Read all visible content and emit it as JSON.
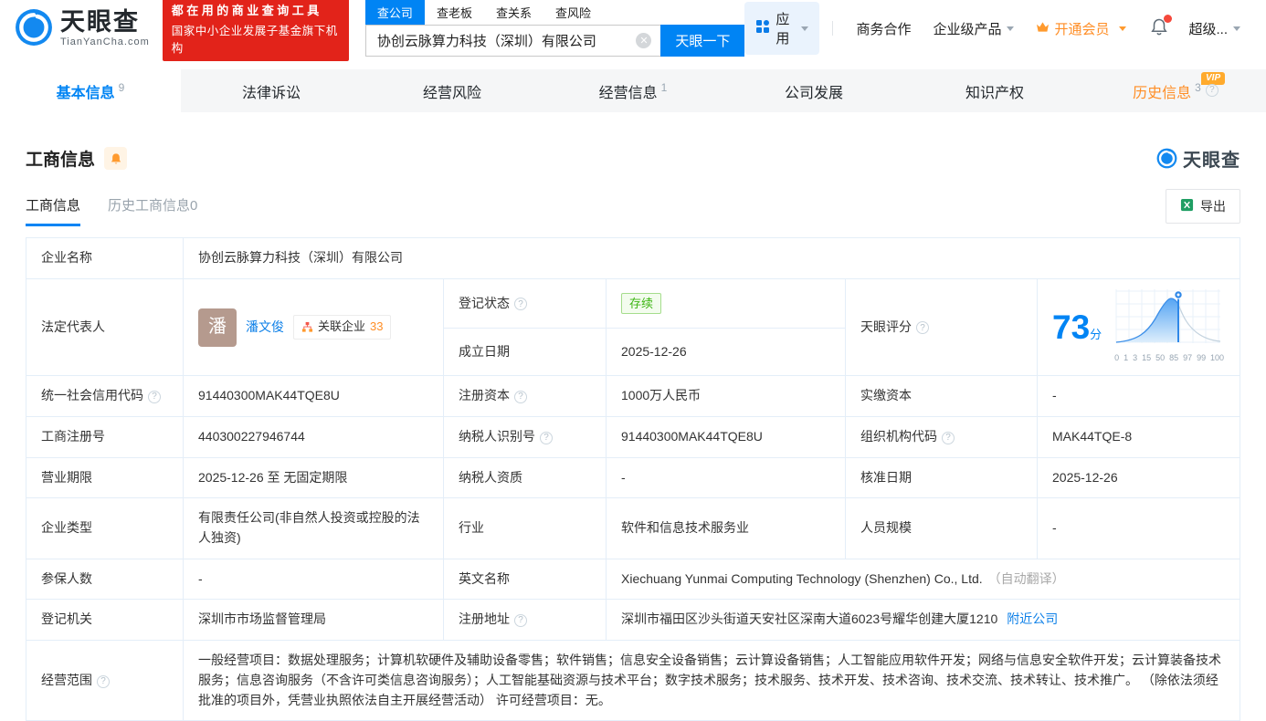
{
  "accent_color": "#0084f4",
  "header": {
    "logo_title": "天眼查",
    "logo_domain": "TianYanCha.com",
    "slogan_line1": "都在用的商业查询工具",
    "slogan_line2": "国家中小企业发展子基金旗下机构",
    "search": {
      "tabs": [
        "查公司",
        "查老板",
        "查关系",
        "查风险"
      ],
      "active_tab": "查公司",
      "value": "协创云脉算力科技（深圳）有限公司",
      "submit_label": "天眼一下"
    },
    "nav": {
      "apps_label": "应用",
      "cooperation_label": "商务合作",
      "enterprise_label": "企业级产品",
      "vip_label": "开通会员",
      "super_label": "超级..."
    }
  },
  "company_tabs": {
    "basic": {
      "label": "基本信息",
      "count": "9"
    },
    "legal": {
      "label": "法律诉讼"
    },
    "risk": {
      "label": "经营风险"
    },
    "operation": {
      "label": "经营信息",
      "count": "1"
    },
    "development": {
      "label": "公司发展"
    },
    "ip": {
      "label": "知识产权"
    },
    "history": {
      "label": "历史信息",
      "count": "3",
      "vip_badge": "VIP"
    }
  },
  "section": {
    "title": "工商信息",
    "subtab_active": "工商信息",
    "subtab_history": "历史工商信息0",
    "export_label": "导出",
    "watermark": "天眼查"
  },
  "score": {
    "label": "天眼评分",
    "value": "73",
    "unit": "分",
    "ticks": [
      "0",
      "1",
      "3",
      "15",
      "50",
      "85",
      "97",
      "99",
      "100"
    ]
  },
  "fields": {
    "company_name": {
      "label": "企业名称",
      "value": "协创云脉算力科技（深圳）有限公司"
    },
    "legal_rep": {
      "label": "法定代表人",
      "avatar": "潘",
      "name": "潘文俊",
      "related_label": "关联企业",
      "related_count": "33"
    },
    "reg_status": {
      "label": "登记状态",
      "value": "存续"
    },
    "est_date": {
      "label": "成立日期",
      "value": "2025-12-26"
    },
    "credit_code": {
      "label": "统一社会信用代码",
      "value": "91440300MAK44TQE8U"
    },
    "reg_capital": {
      "label": "注册资本",
      "value": "1000万人民币"
    },
    "paid_capital": {
      "label": "实缴资本",
      "value": "-"
    },
    "reg_number": {
      "label": "工商注册号",
      "value": "440300227946744"
    },
    "taxpayer_id": {
      "label": "纳税人识别号",
      "value": "91440300MAK44TQE8U"
    },
    "org_code": {
      "label": "组织机构代码",
      "value": "MAK44TQE-8"
    },
    "business_term": {
      "label": "营业期限",
      "value": "2025-12-26 至 无固定期限"
    },
    "taxpayer_quality": {
      "label": "纳税人资质",
      "value": "-"
    },
    "approval_date": {
      "label": "核准日期",
      "value": "2025-12-26"
    },
    "company_type": {
      "label": "企业类型",
      "value": "有限责任公司(非自然人投资或控股的法人独资)"
    },
    "industry": {
      "label": "行业",
      "value": "软件和信息技术服务业"
    },
    "staff_size": {
      "label": "人员规模",
      "value": "-"
    },
    "insured_count": {
      "label": "参保人数",
      "value": "-"
    },
    "english_name": {
      "label": "英文名称",
      "value": "Xiechuang Yunmai Computing Technology (Shenzhen) Co., Ltd.",
      "note": "（自动翻译）"
    },
    "reg_authority": {
      "label": "登记机关",
      "value": "深圳市市场监督管理局"
    },
    "reg_address": {
      "label": "注册地址",
      "value": "深圳市福田区沙头街道天安社区深南大道6023号耀华创建大厦1210",
      "link": "附近公司"
    },
    "business_scope": {
      "label": "经营范围",
      "value": "一般经营项目：数据处理服务；计算机软硬件及辅助设备零售；软件销售；信息安全设备销售；云计算设备销售；人工智能应用软件开发；网络与信息安全软件开发；云计算装备技术服务；信息咨询服务（不含许可类信息咨询服务）；人工智能基础资源与技术平台；数字技术服务；技术服务、技术开发、技术咨询、技术交流、技术转让、技术推广。 （除依法须经批准的项目外，凭营业执照依法自主开展经营活动） 许可经营项目：无。"
    }
  }
}
